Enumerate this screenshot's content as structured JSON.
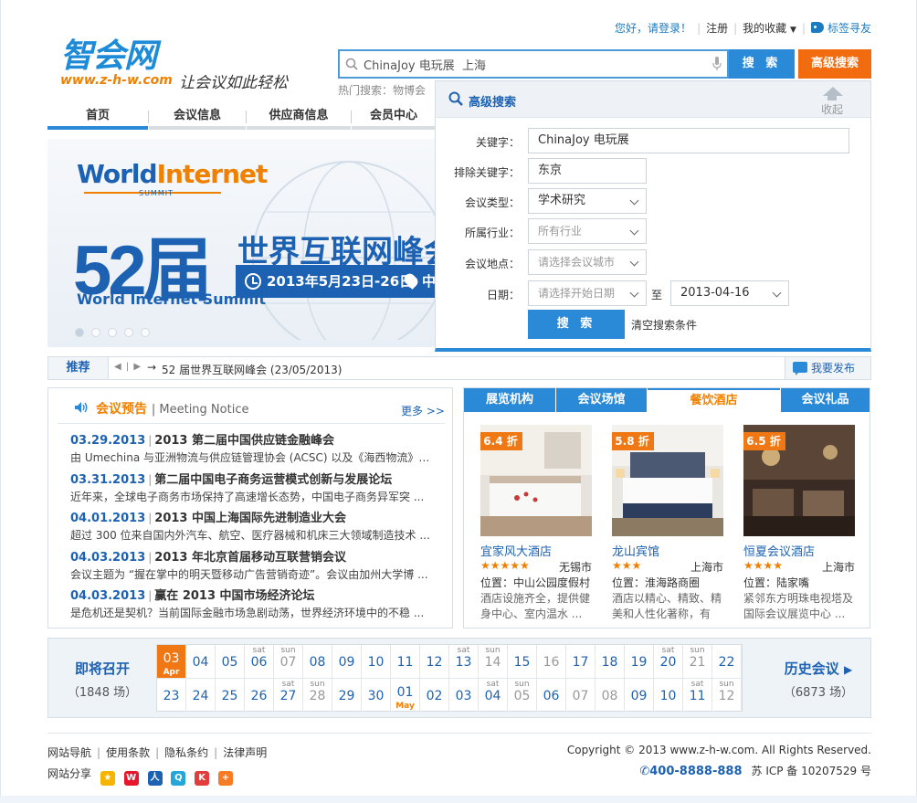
{
  "header": {
    "logo_text": "智会网",
    "logo_url": "www.z-h-w.com",
    "logo_slogan": "让会议如此轻松",
    "greeting": "您好，请登录！",
    "register": "注册",
    "favorites": "我的收藏",
    "tag_finder": "标签寻友",
    "search_value": "ChinaJoy 电玩展  上海",
    "search_button": "搜 索",
    "advanced_button": "高级搜索",
    "hot_search": "热门搜索：物博会"
  },
  "nav": {
    "items": [
      "首页",
      "会议信息",
      "供应商信息",
      "会员中心"
    ]
  },
  "banner": {
    "logo_world": "World",
    "logo_internet": "Internet",
    "logo_summit": "SUMMIT",
    "number": "52届",
    "title": "世界互联网峰会",
    "en_name": "World Internet Summit",
    "date_text": "2013年5月23日-26日",
    "after_pin": "中"
  },
  "advanced_search": {
    "title": "高级搜索",
    "collapse": "收起",
    "keyword_label": "关键字：",
    "keyword_value": "ChinaJoy 电玩展",
    "exclude_label": "排除关键字：",
    "exclude_value": "东京",
    "type_label": "会议类型：",
    "type_value": "学术研究",
    "industry_label": "所属行业：",
    "industry_placeholder": "所有行业",
    "location_label": "会议地点：",
    "location_placeholder": "请选择会议城市",
    "date_label": "日期：",
    "date_start_placeholder": "请选择开始日期",
    "date_to": "至",
    "date_end_value": "2013-04-16",
    "search_button": "搜 索",
    "clear_text": "清空搜索条件"
  },
  "recommend": {
    "label": "推荐",
    "controls": "◀ | ▶",
    "arrow": "→",
    "text": "52 届世界互联网峰会 (23/05/2013)",
    "publish": "我要发布"
  },
  "notice": {
    "title": "会议预告",
    "title_en": "Meeting Notice",
    "more": "更多 >>",
    "items": [
      {
        "date": "03.29.2013",
        "title": "2013 第二届中国供应链金融峰会",
        "desc": "由 Umechina 与亚洲物流与供应链管理协会 (ACSC) 以及《海西物流》等 ..."
      },
      {
        "date": "03.31.2013",
        "title": "第二届中国电子商务运营模式创新与发展论坛",
        "desc": "近年来，全球电子商务市场保持了高速增长态势，中国电子商务异军突 ..."
      },
      {
        "date": "04.01.2013",
        "title": "2013 中国上海国际先进制造业大会",
        "desc": "超过 300 位来自国内外汽车、航空、医疗器械和机床三大领域制造技术 ..."
      },
      {
        "date": "04.03.2013",
        "title": "2013 年北京首届移动互联营销会议",
        "desc": "会议主题为 “握在掌中的明天暨移动广告营销奇迹”。会议由加州大学博 ..."
      },
      {
        "date": "04.03.2013",
        "title": "赢在 2013 中国市场经济论坛",
        "desc": "是危机还是契机？当前国际金融市场急剧动荡，世界经济环境中的不稳 ..."
      }
    ]
  },
  "hotels": {
    "tabs": [
      "展览机构",
      "会议场馆",
      "餐饮酒店",
      "会议礼品"
    ],
    "cards": [
      {
        "discount": "6.4 折",
        "name": "宜家风大酒店",
        "stars": "★★★★★",
        "city": "无锡市",
        "location": "位置：中山公园度假村",
        "desc": "酒店设施齐全，提供健身中心、室内温水 ..."
      },
      {
        "discount": "5.8 折",
        "name": "龙山宾馆",
        "stars": "★★★",
        "city": "上海市",
        "location": "位置：淮海路商圈",
        "desc": "酒店以精心、精致、精美和人性化著称，有 ..."
      },
      {
        "discount": "6.5 折",
        "name": "恒夏会议酒店",
        "stars": "★★★★",
        "city": "上海市",
        "location": "位置：陆家嘴",
        "desc": "紧邻东方明珠电视塔及国际会议展览中心 ..."
      }
    ]
  },
  "calendar": {
    "left_title": "即将召开",
    "left_count": "（1848 场）",
    "right_title": "历史会议",
    "right_count": "（6873 场）",
    "row1": [
      {
        "d": "03",
        "m": "Apr",
        "w": ""
      },
      {
        "d": "04",
        "w": ""
      },
      {
        "d": "05",
        "w": ""
      },
      {
        "d": "06",
        "w": "sat"
      },
      {
        "d": "07",
        "w": "sun"
      },
      {
        "d": "08",
        "w": ""
      },
      {
        "d": "09",
        "w": ""
      },
      {
        "d": "10",
        "w": ""
      },
      {
        "d": "11",
        "w": ""
      },
      {
        "d": "12",
        "w": ""
      },
      {
        "d": "13",
        "w": "sat"
      },
      {
        "d": "14",
        "w": "sun"
      },
      {
        "d": "15",
        "w": ""
      },
      {
        "d": "16",
        "w": ""
      },
      {
        "d": "17",
        "w": ""
      },
      {
        "d": "18",
        "w": ""
      },
      {
        "d": "19",
        "w": ""
      },
      {
        "d": "20",
        "w": "sat"
      },
      {
        "d": "21",
        "w": "sun"
      },
      {
        "d": "22",
        "w": ""
      }
    ],
    "row2": [
      {
        "d": "23",
        "w": ""
      },
      {
        "d": "24",
        "w": ""
      },
      {
        "d": "25",
        "w": ""
      },
      {
        "d": "26",
        "w": ""
      },
      {
        "d": "27",
        "w": "sat"
      },
      {
        "d": "28",
        "w": "sun"
      },
      {
        "d": "29",
        "w": ""
      },
      {
        "d": "30",
        "w": ""
      },
      {
        "d": "01",
        "m": "May",
        "w": ""
      },
      {
        "d": "02",
        "w": ""
      },
      {
        "d": "03",
        "w": ""
      },
      {
        "d": "04",
        "w": "sat"
      },
      {
        "d": "05",
        "w": "sun"
      },
      {
        "d": "06",
        "w": ""
      },
      {
        "d": "07",
        "w": ""
      },
      {
        "d": "08",
        "w": ""
      },
      {
        "d": "09",
        "w": ""
      },
      {
        "d": "10",
        "w": ""
      },
      {
        "d": "11",
        "w": "sat"
      },
      {
        "d": "12",
        "w": "sun"
      }
    ]
  },
  "footer": {
    "links": [
      "网站导航",
      "使用条款",
      "隐私条约",
      "法律声明"
    ],
    "share_label": "网站分享",
    "copyright": "Copyright © 2013 www.z-h-w.com. All Rights Reserved.",
    "phone": "400-8888-888",
    "icp": "苏 ICP 备 10207529 号"
  },
  "colors": {
    "primary_blue": "#2b8ad8",
    "dark_blue": "#1d62b2",
    "orange": "#f08000"
  }
}
